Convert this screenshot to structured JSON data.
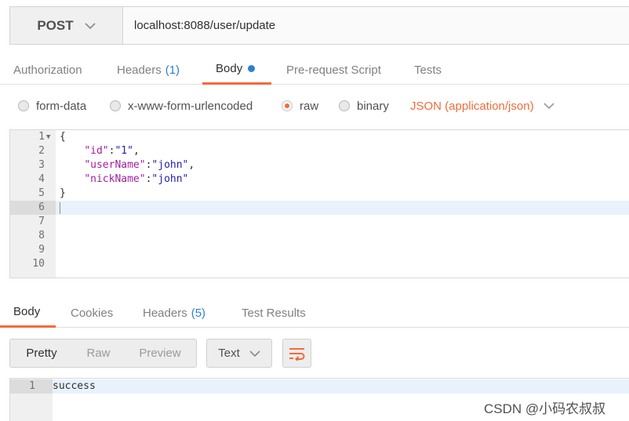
{
  "request": {
    "method": "POST",
    "url": "localhost:8088/user/update"
  },
  "request_tabs": {
    "authorization": "Authorization",
    "headers": "Headers",
    "headers_count": "(1)",
    "body": "Body",
    "prerequest": "Pre-request Script",
    "tests": "Tests"
  },
  "body_types": {
    "form_data": "form-data",
    "urlencoded": "x-www-form-urlencoded",
    "raw": "raw",
    "binary": "binary",
    "selected": "raw",
    "content_type": "JSON (application/json)"
  },
  "editor": {
    "line_numbers": [
      "1",
      "2",
      "3",
      "4",
      "5",
      "6",
      "7",
      "8",
      "9",
      "10"
    ],
    "line1": "{",
    "line2_key": "\"id\"",
    "line2_value": "\"1\"",
    "line3_key": "\"userName\"",
    "line3_value": "\"john\"",
    "line4_key": "\"nickName\"",
    "line4_value": "\"john\"",
    "line5": "}"
  },
  "response_tabs": {
    "body": "Body",
    "cookies": "Cookies",
    "headers": "Headers",
    "headers_count": "(5)",
    "test_results": "Test Results"
  },
  "response_toolbar": {
    "pretty": "Pretty",
    "raw": "Raw",
    "preview": "Preview",
    "format": "Text"
  },
  "response": {
    "line_number": "1",
    "text": "success"
  },
  "watermark": "CSDN @小码农叔叔",
  "colors": {
    "accent": "#f26b3a",
    "link_blue": "#2f7fd1"
  }
}
